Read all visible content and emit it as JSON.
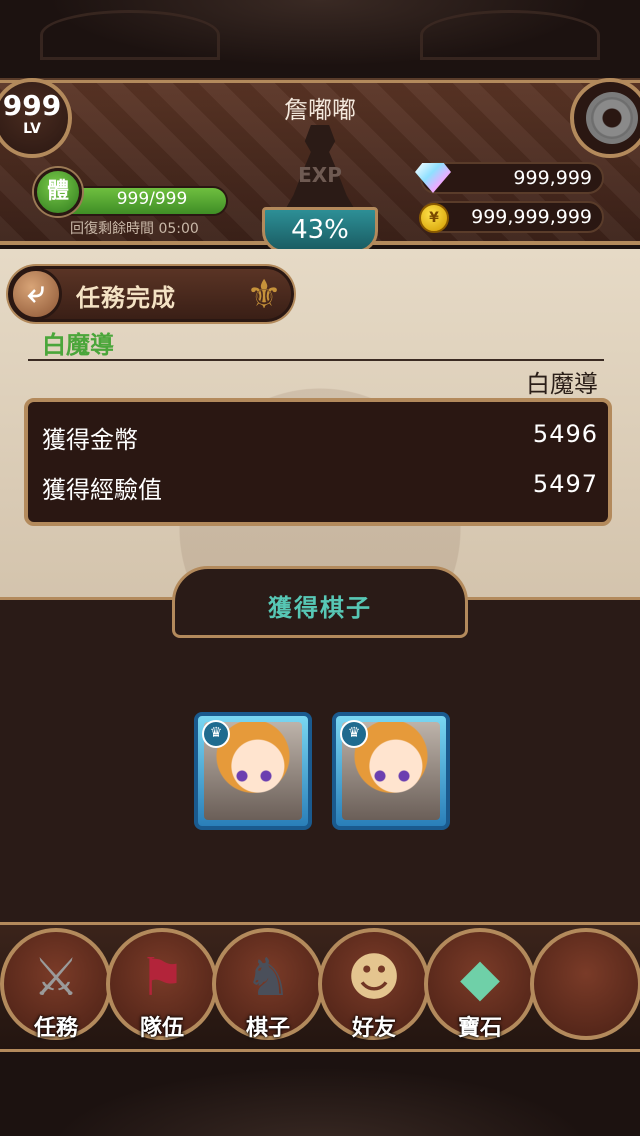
{
  "player": {
    "level": "999",
    "level_tag": "LV",
    "name": "詹嘟嘟",
    "exp_tag": "EXP",
    "exp_percent": "43%",
    "stamina": "999/999",
    "stamina_icon_text": "體",
    "recover_text": "回復剩餘時間 05:00",
    "gems": "999,999",
    "coins": "999,999,999"
  },
  "header": {
    "title": "任務完成"
  },
  "quest": {
    "name": "白魔導",
    "name_right": "白魔導"
  },
  "rewards": {
    "gold_label": "獲得金幣",
    "gold_value": "5496",
    "exp_label": "獲得經驗值",
    "exp_value": "5497"
  },
  "pieces": {
    "title": "獲得棋子",
    "count": 2
  },
  "nav": {
    "quest": "任務",
    "team": "隊伍",
    "pieces": "棋子",
    "friends": "好友",
    "gems": "寶石"
  },
  "icons": {
    "back": "back-arrow-icon",
    "settings": "gear-icon",
    "gem": "diamond-icon",
    "coin": "coin-icon",
    "fleur": "fleur-de-lis-icon",
    "crown": "crown-icon"
  },
  "colors": {
    "accent_gold": "#b38a5c",
    "exp_teal": "#2d8f96",
    "stamina_green": "#4aa63a",
    "pieces_title": "#57c7b5"
  }
}
